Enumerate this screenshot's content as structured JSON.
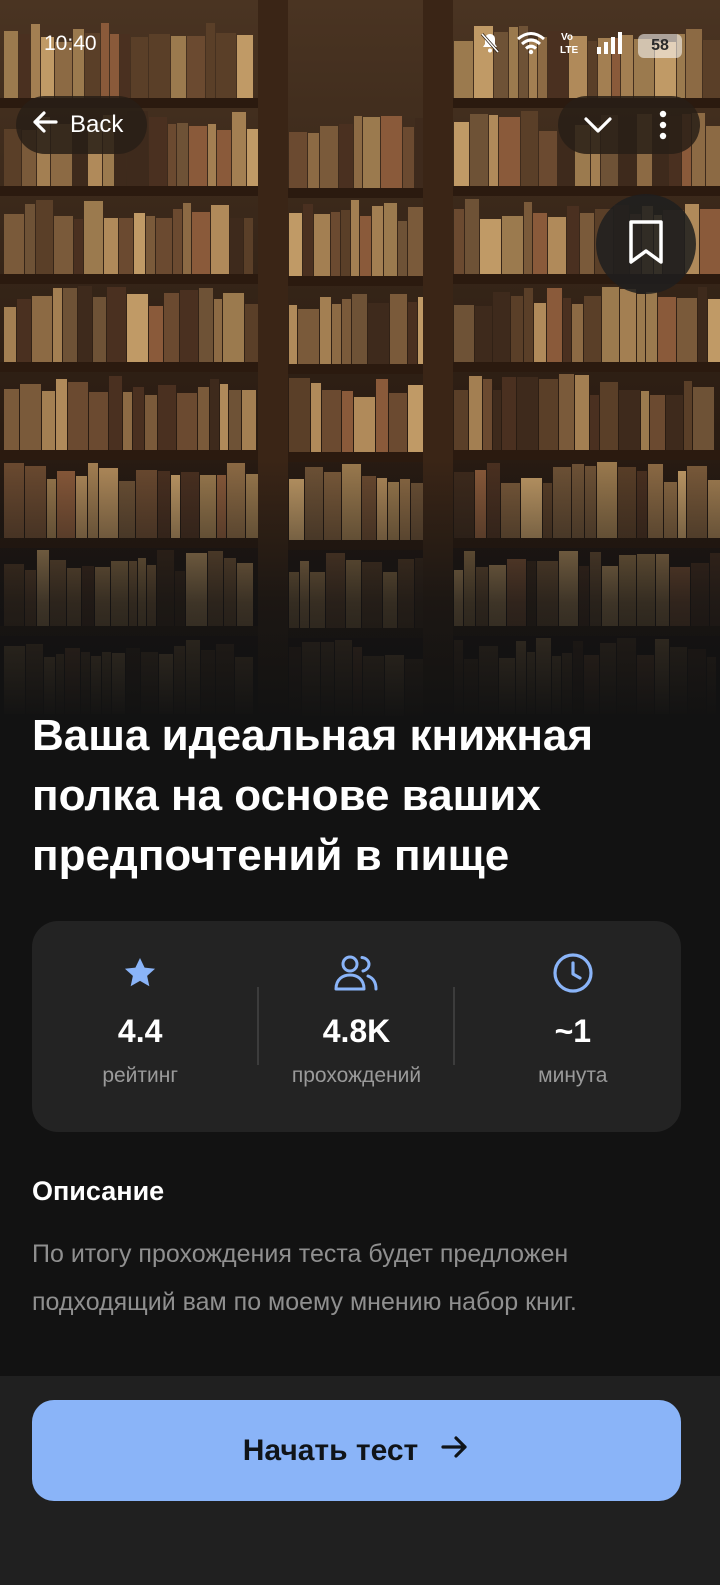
{
  "status_bar": {
    "time": "10:40",
    "battery": "58",
    "icons": [
      "bell-off-icon",
      "wifi-icon",
      "volte-icon",
      "signal-icon",
      "battery-icon"
    ]
  },
  "header": {
    "back_label": "Back",
    "icons": [
      "arrow-left-icon",
      "chevron-down-icon",
      "more-vertical-icon",
      "bookmark-icon"
    ]
  },
  "quiz": {
    "title": "Ваша идеальная книжная полка на основе ваших предпочтений в пище"
  },
  "stats": [
    {
      "icon": "star-icon",
      "value": "4.4",
      "label": "рейтинг"
    },
    {
      "icon": "users-icon",
      "value": "4.8K",
      "label": "прохождений"
    },
    {
      "icon": "clock-icon",
      "value": "~1",
      "label": "минута"
    }
  ],
  "description": {
    "heading": "Описание",
    "text": "По итогу прохождения теста будет предложен подходящий вам по моему мнению набор книг."
  },
  "actions": {
    "start_label": "Начать тест",
    "start_icon": "arrow-right-icon"
  },
  "colors": {
    "background": "#121212",
    "card": "#232323",
    "accent": "#8ab4f8",
    "bottom_bar": "#202020"
  }
}
